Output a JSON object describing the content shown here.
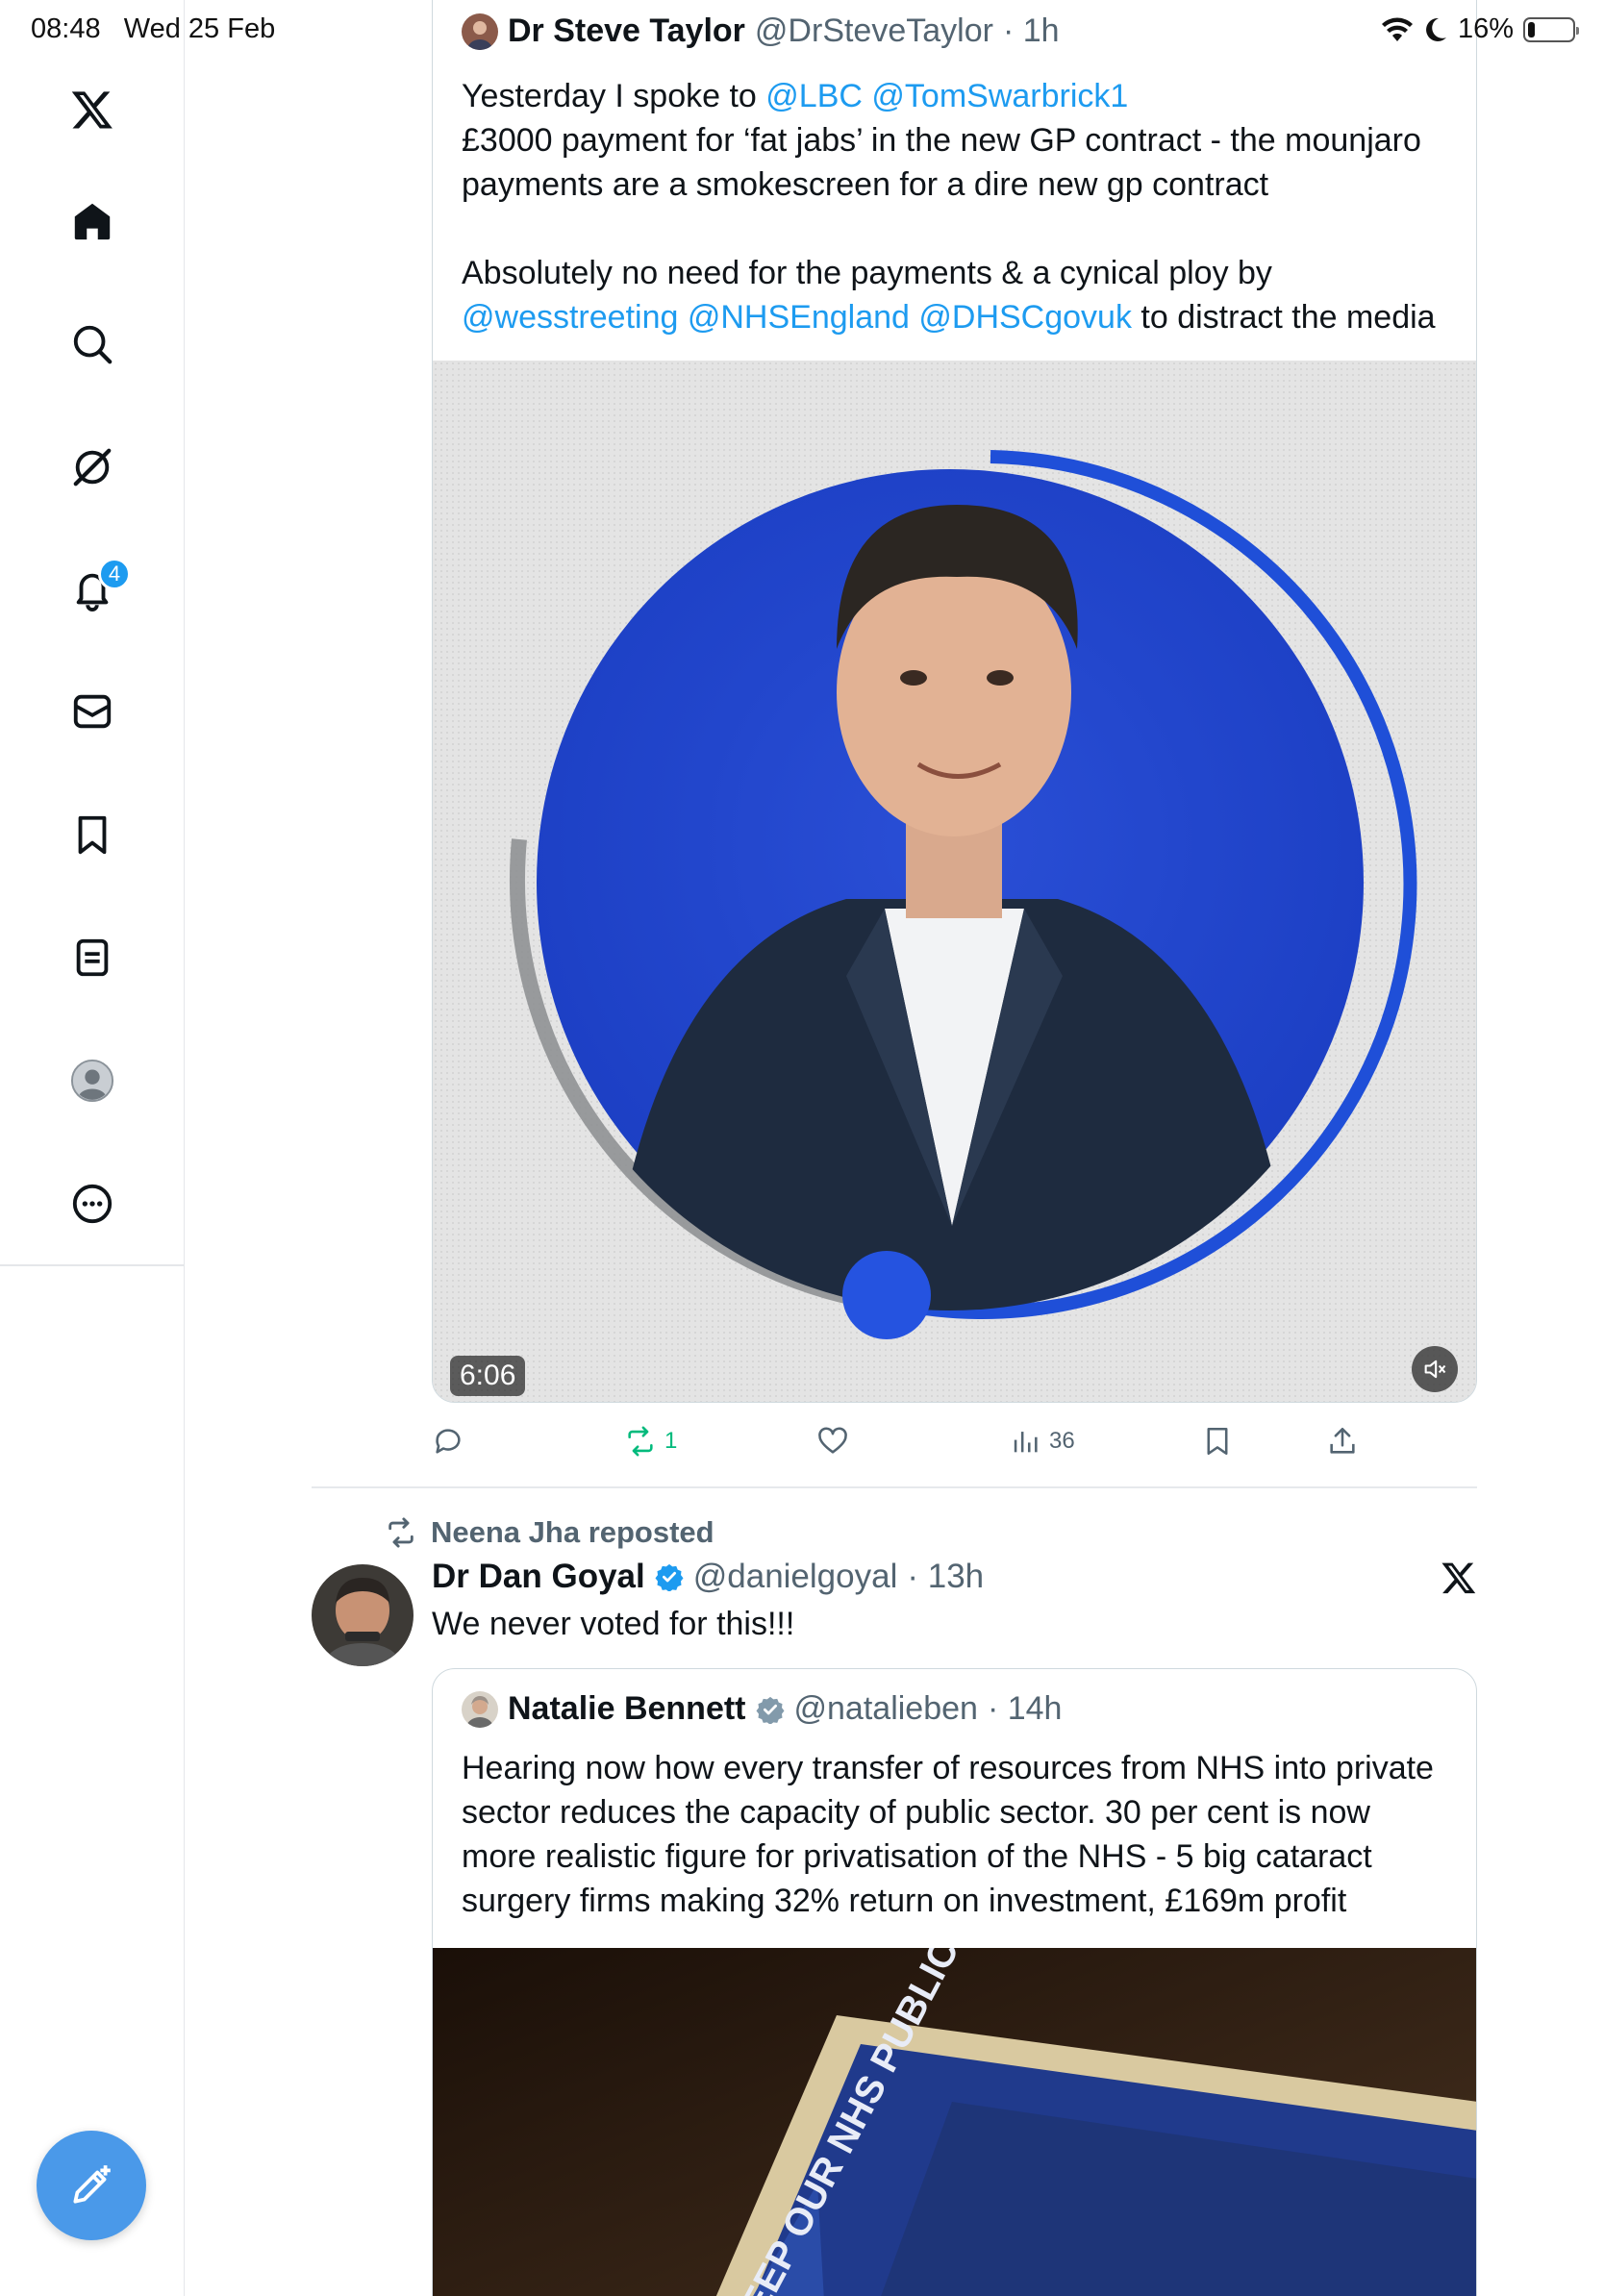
{
  "status_bar": {
    "time": "08:48",
    "date": "Wed 25 Feb",
    "battery": "16%",
    "battery_level": 0.16
  },
  "sidebar": {
    "items": [
      {
        "name": "x-logo-icon"
      },
      {
        "name": "home-icon"
      },
      {
        "name": "search-icon"
      },
      {
        "name": "grok-icon"
      },
      {
        "name": "notifications-icon",
        "badge": "4"
      },
      {
        "name": "messages-icon"
      },
      {
        "name": "bookmarks-icon"
      },
      {
        "name": "lists-icon"
      },
      {
        "name": "profile-icon"
      },
      {
        "name": "more-icon"
      }
    ],
    "compose_icon": "compose-post-icon"
  },
  "tweet1": {
    "author_name": "Dr Steve Taylor",
    "author_handle": "@DrSteveTaylor",
    "time": "· 1h",
    "text": {
      "line1_prefix": "Yesterday I spoke to ",
      "line1_mention1": "@LBC",
      "line1_mention2": "@TomSwarbrick1",
      "line2": "£3000 payment for ‘fat jabs’ in the new GP contract - the mounjaro",
      "line3": "payments are a smokescreen for a dire new gp contract",
      "line4": "Absolutely no need for the payments & a cynical ploy by",
      "line5_mention1": "@wesstreeting",
      "line5_mention2": "@NHSEngland",
      "line5_mention3": "@DHSCgovuk",
      "line5_suffix": " to distract the media"
    },
    "video": {
      "duration": "6:06",
      "muted": true
    },
    "actions": {
      "reply_count": "",
      "repost_count": "1",
      "like_count": "",
      "views_count": "36"
    },
    "colors": {
      "repost_active": "#00ba7c",
      "mention": "#1d9bf0"
    }
  },
  "tweet2": {
    "repost_by": "Neena Jha reposted",
    "author_name": "Dr Dan Goyal",
    "author_handle": "@danielgoyal",
    "time": "· 13h",
    "text": "We never voted for this!!!",
    "quote": {
      "author_name": "Natalie Bennett",
      "author_handle": "@natalieben",
      "time": "· 14h",
      "line1": "Hearing now how every transfer of resources from NHS into private",
      "line2": "sector reduces the capacity of public sector. 30 per cent is now",
      "line3": "more realistic figure for privatisation of the NHS - 5 big cataract",
      "line4": "surgery firms making 32% return on investment, £169m profit",
      "image_text": "KEEP OUR NHS PUBLIC"
    }
  }
}
